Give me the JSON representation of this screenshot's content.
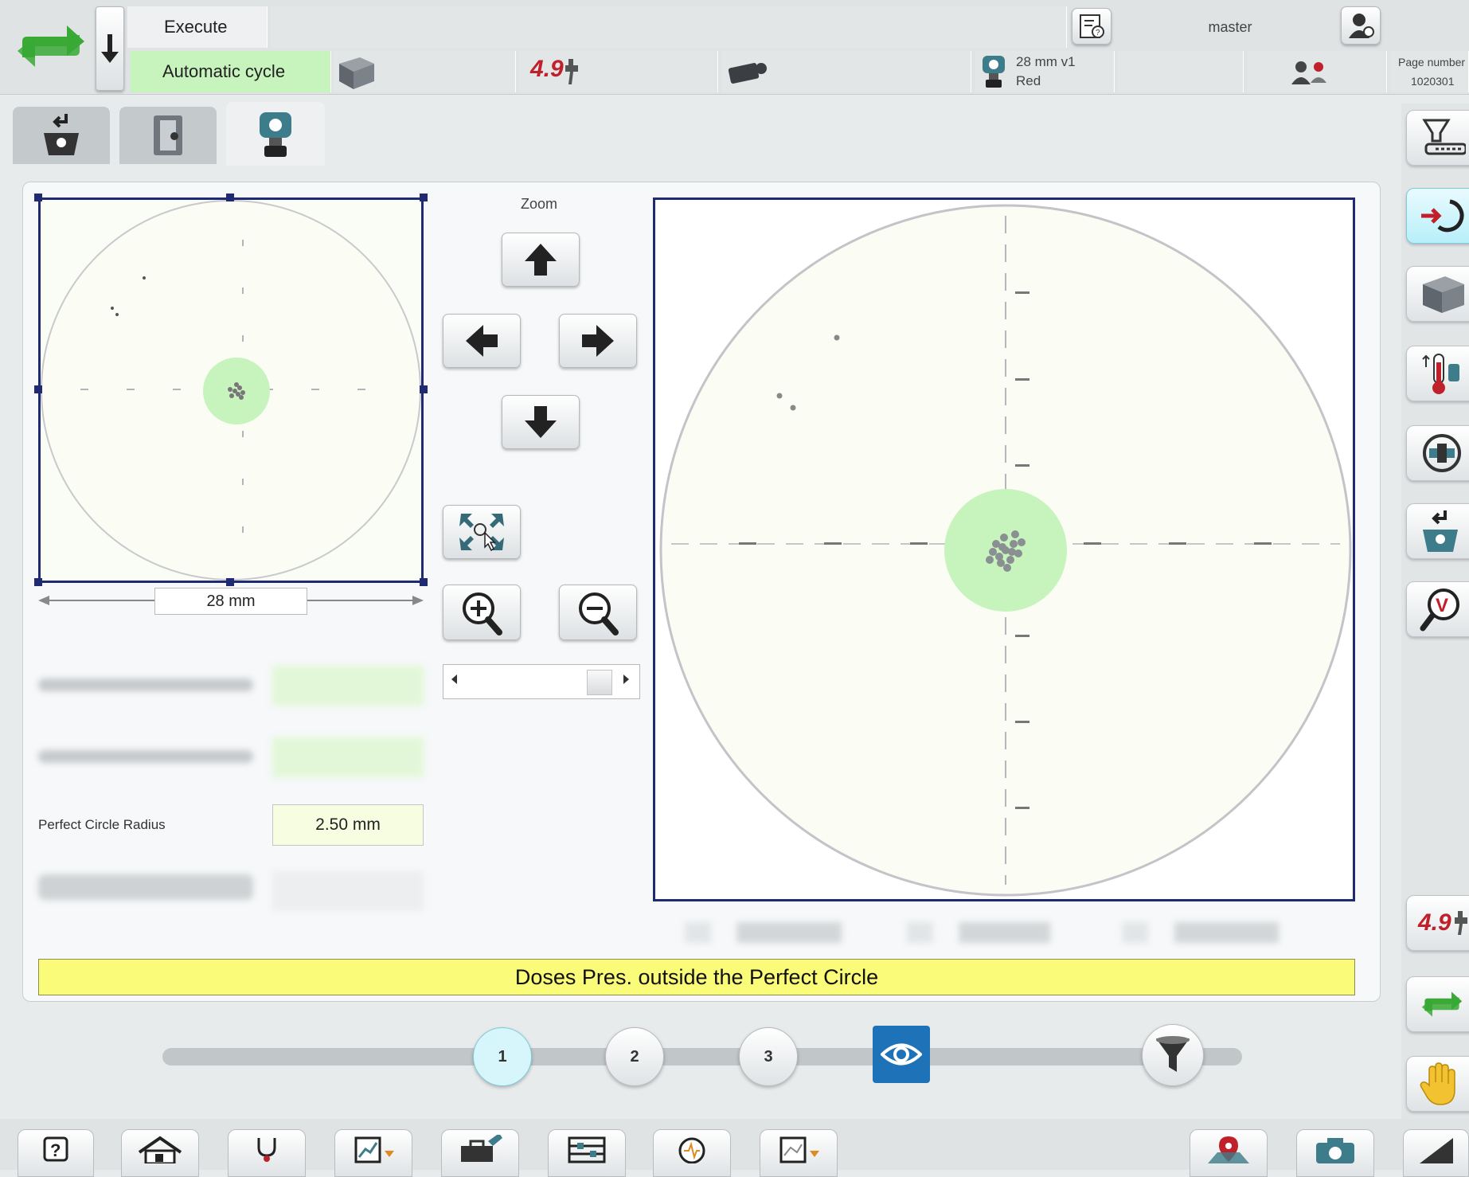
{
  "header": {
    "execute_label": "Execute",
    "mode_label": "Automatic cycle",
    "weight_badge": "4.9",
    "probe_name": "28 mm v1",
    "probe_color": "Red",
    "user": "master",
    "page_number_label": "Page number",
    "page_number_value": "1020301"
  },
  "tabs": [
    {
      "icon": "dose-cup-icon"
    },
    {
      "icon": "machine-icon"
    },
    {
      "icon": "probe-icon",
      "active": true
    }
  ],
  "left_view": {
    "width_label": "28 mm"
  },
  "zoom": {
    "title": "Zoom"
  },
  "parameters": {
    "perfect_circle_radius_label": "Perfect Circle Radius",
    "perfect_circle_radius_value": "2.50 mm"
  },
  "status_message": "Doses Pres. outside the Perfect Circle",
  "steps": [
    "1",
    "2",
    "3"
  ],
  "right_sidebar": {
    "weight_badge": "4.9"
  },
  "colors": {
    "accent_green": "#c7f3bd",
    "highlight_yellow": "#fbfb7a",
    "active_blue": "#1e73b8",
    "frame_navy": "#1f2a73",
    "warning_red": "#c0202a"
  }
}
